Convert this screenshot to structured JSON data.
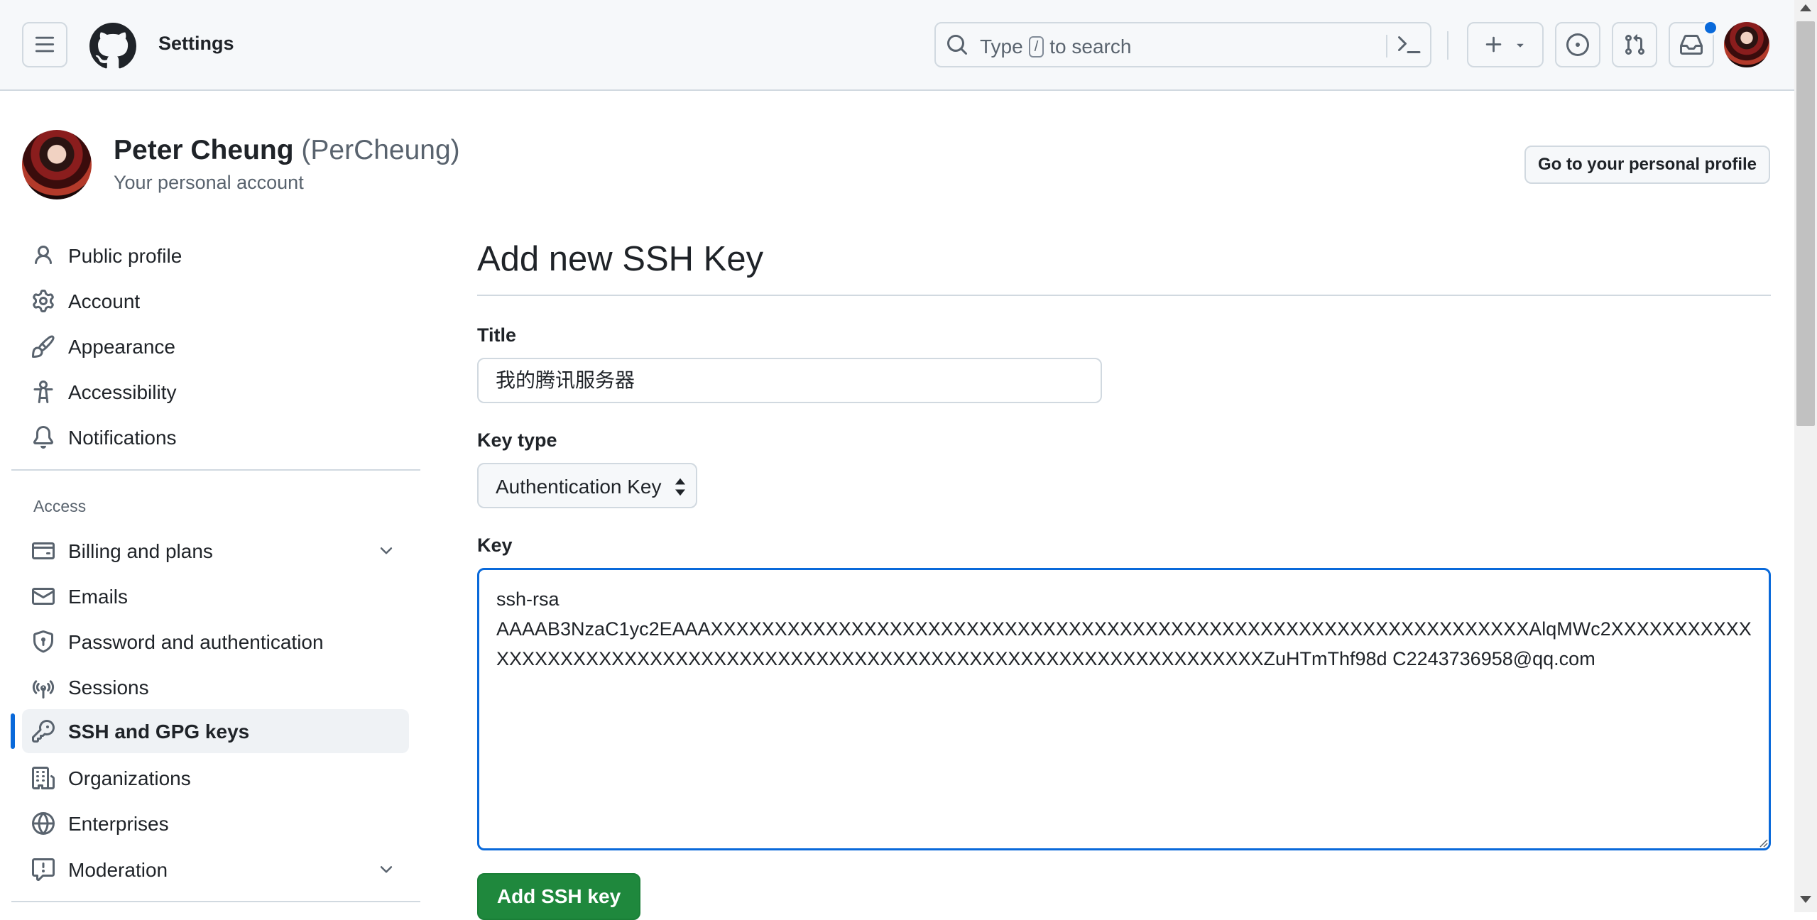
{
  "header": {
    "title": "Settings",
    "search_prefix": "Type",
    "search_key": "/",
    "search_suffix": "to search",
    "icons": [
      "hamburger-menu-icon",
      "github-logo-icon",
      "search-icon",
      "command-palette-icon",
      "plus-icon",
      "issues-icon",
      "pull-requests-icon",
      "inbox-icon"
    ]
  },
  "profile": {
    "name": "Peter Cheung",
    "login": "(PerCheung)",
    "subtitle": "Your personal account",
    "profile_button": "Go to your personal profile"
  },
  "sidebar": {
    "items": [
      {
        "label": "Public profile",
        "icon": "person-icon"
      },
      {
        "label": "Account",
        "icon": "gear-icon"
      },
      {
        "label": "Appearance",
        "icon": "paintbrush-icon"
      },
      {
        "label": "Accessibility",
        "icon": "accessibility-icon"
      },
      {
        "label": "Notifications",
        "icon": "bell-icon"
      }
    ],
    "access_heading": "Access",
    "access_items": [
      {
        "label": "Billing and plans",
        "icon": "credit-card-icon",
        "expandable": true
      },
      {
        "label": "Emails",
        "icon": "mail-icon"
      },
      {
        "label": "Password and authentication",
        "icon": "shield-lock-icon"
      },
      {
        "label": "Sessions",
        "icon": "broadcast-icon"
      },
      {
        "label": "SSH and GPG keys",
        "icon": "key-icon",
        "active": true
      },
      {
        "label": "Organizations",
        "icon": "organization-icon"
      },
      {
        "label": "Enterprises",
        "icon": "globe-icon"
      },
      {
        "label": "Moderation",
        "icon": "report-icon",
        "expandable": true
      }
    ]
  },
  "form": {
    "heading": "Add new SSH Key",
    "title_label": "Title",
    "title_value": "我的腾讯服务器",
    "key_type_label": "Key type",
    "key_type_value": "Authentication Key",
    "key_label": "Key",
    "key_line1": "ssh-rsa",
    "key_line2": "AAAAB3NzaC1yc2EAAAXXXXXXXXXXXXXXXXXXXXXXXXXXXXXXXXXXXXXXXXXXXXXXXXXXXXXXXXXXXXXXXXAlqMWc2XXXXXXXXXXXXXXXXXXXXXXXXXXXXXXXXXXXXXXXXXXXXXXXXXXXXXXXXXXXXXXXXXXXXXXXZuHTmThf98d C2243736958@qq.com",
    "submit_label": "Add SSH key"
  },
  "colors": {
    "accent": "#0969da",
    "primary_button": "#1f883d",
    "header_bg": "#f6f8fa"
  }
}
